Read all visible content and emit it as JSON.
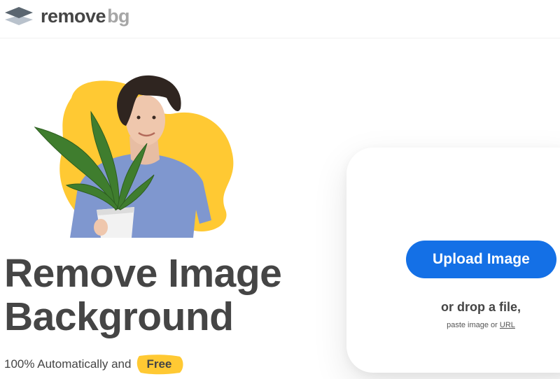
{
  "header": {
    "logo_word_main": "remove",
    "logo_word_accent": "bg",
    "logo_icon": "stacked-layers-icon"
  },
  "hero": {
    "headline_line1": "Remove Image",
    "headline_line2": "Background",
    "subline_text": "100% Automatically and",
    "free_badge": "Free"
  },
  "upload": {
    "button_label": "Upload Image",
    "drop_text": "or drop a file,",
    "paste_prefix": "paste image or",
    "url_link": "URL"
  },
  "colors": {
    "primary_blue": "#1470e6",
    "accent_yellow": "#ffc933",
    "text_dark": "#454545",
    "logo_grey": "#a6a6a6"
  }
}
